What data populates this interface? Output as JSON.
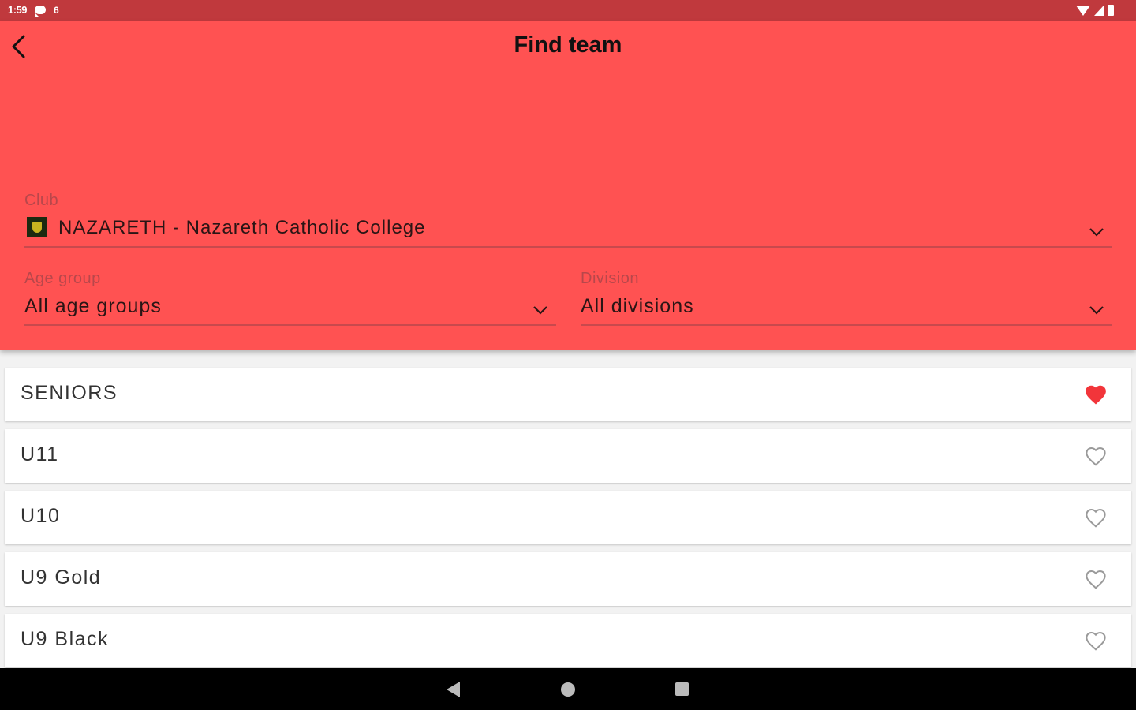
{
  "status_bar": {
    "time": "1:59",
    "notification_badge": "6",
    "icons": [
      "message-icon",
      "wifi-icon",
      "signal-icon",
      "battery-icon"
    ]
  },
  "header": {
    "title": "Find team",
    "back_icon": "back-arrow-icon",
    "background": "#ff5252"
  },
  "filters": {
    "club": {
      "label": "Club",
      "value": "NAZARETH - Nazareth Catholic College"
    },
    "age_group": {
      "label": "Age group",
      "value": "All age groups"
    },
    "division": {
      "label": "Division",
      "value": "All divisions"
    }
  },
  "teams": [
    {
      "name": "SENIORS",
      "favorite": true
    },
    {
      "name": "U11",
      "favorite": false
    },
    {
      "name": "U10",
      "favorite": false
    },
    {
      "name": "U9 Gold",
      "favorite": false
    },
    {
      "name": "U9 Black",
      "favorite": false
    }
  ],
  "colors": {
    "accent": "#ff5252",
    "status_bar": "#c0393d",
    "favorite_heart": "#f2353a",
    "empty_heart": "#9a9a9a"
  },
  "nav_bar": {
    "icons": [
      "nav-back-icon",
      "nav-home-icon",
      "nav-recents-icon"
    ]
  }
}
